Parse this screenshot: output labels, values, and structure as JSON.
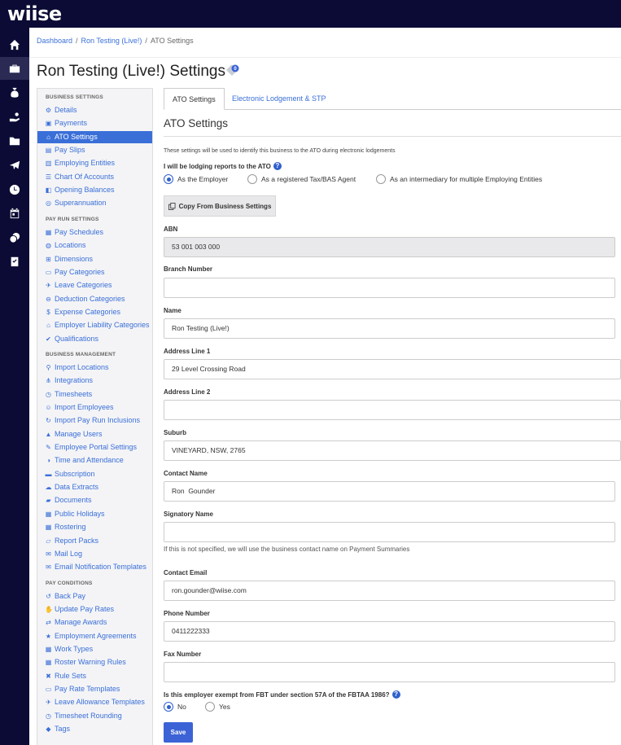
{
  "app": {
    "logo": "wiise"
  },
  "rail": [
    {
      "icon": "home-icon"
    },
    {
      "icon": "briefcase-icon"
    },
    {
      "icon": "moneybag-icon"
    },
    {
      "icon": "hand-coins-icon"
    },
    {
      "icon": "folder-icon"
    },
    {
      "icon": "plane-icon"
    },
    {
      "icon": "clock-icon"
    },
    {
      "icon": "calendar-icon"
    },
    {
      "icon": "coins-icon"
    },
    {
      "icon": "clipboard-check-icon"
    }
  ],
  "breadcrumb": {
    "items": [
      "Dashboard",
      "Ron Testing (Live!)",
      "ATO Settings"
    ],
    "sep": "/"
  },
  "page": {
    "title": "Ron Testing (Live!) Settings",
    "tag_badge": "0"
  },
  "sidebar": {
    "sections": [
      {
        "title": "BUSINESS SETTINGS",
        "items": [
          {
            "label": "Details",
            "icon": "gear-icon"
          },
          {
            "label": "Payments",
            "icon": "save-icon"
          },
          {
            "label": "ATO Settings",
            "icon": "bank-icon",
            "active": true
          },
          {
            "label": "Pay Slips",
            "icon": "file-icon"
          },
          {
            "label": "Employing Entities",
            "icon": "building-icon"
          },
          {
            "label": "Chart Of Accounts",
            "icon": "list-icon"
          },
          {
            "label": "Opening Balances",
            "icon": "ledger-icon"
          },
          {
            "label": "Superannuation",
            "icon": "lifebuoy-icon"
          }
        ]
      },
      {
        "title": "PAY RUN SETTINGS",
        "items": [
          {
            "label": "Pay Schedules",
            "icon": "calendar-icon"
          },
          {
            "label": "Locations",
            "icon": "globe-icon"
          },
          {
            "label": "Dimensions",
            "icon": "grid-icon"
          },
          {
            "label": "Pay Categories",
            "icon": "money-icon"
          },
          {
            "label": "Leave Categories",
            "icon": "plane-icon"
          },
          {
            "label": "Deduction Categories",
            "icon": "minus-circle-icon"
          },
          {
            "label": "Expense Categories",
            "icon": "dollar-circle-icon"
          },
          {
            "label": "Employer Liability Categories",
            "icon": "bank-icon"
          },
          {
            "label": "Qualifications",
            "icon": "check-icon"
          }
        ]
      },
      {
        "title": "BUSINESS MANAGEMENT",
        "items": [
          {
            "label": "Import Locations",
            "icon": "map-pin-icon"
          },
          {
            "label": "Integrations",
            "icon": "sitemap-icon"
          },
          {
            "label": "Timesheets",
            "icon": "clock-icon"
          },
          {
            "label": "Import Employees",
            "icon": "users-icon"
          },
          {
            "label": "Import Pay Run Inclusions",
            "icon": "refresh-icon"
          },
          {
            "label": "Manage Users",
            "icon": "lock-icon"
          },
          {
            "label": "Employee Portal Settings",
            "icon": "pencil-icon"
          },
          {
            "label": "Time and Attendance",
            "icon": "user-clock-icon"
          },
          {
            "label": "Subscription",
            "icon": "credit-card-icon"
          },
          {
            "label": "Data Extracts",
            "icon": "cloud-download-icon"
          },
          {
            "label": "Documents",
            "icon": "folder-icon"
          },
          {
            "label": "Public Holidays",
            "icon": "calendar-icon"
          },
          {
            "label": "Rostering",
            "icon": "calendar-grid-icon"
          },
          {
            "label": "Report Packs",
            "icon": "folder-open-icon"
          },
          {
            "label": "Mail Log",
            "icon": "envelope-icon"
          },
          {
            "label": "Email Notification Templates",
            "icon": "envelope-icon"
          }
        ]
      },
      {
        "title": "PAY CONDITIONS",
        "items": [
          {
            "label": "Back Pay",
            "icon": "history-icon"
          },
          {
            "label": "Update Pay Rates",
            "icon": "hand-coins-icon"
          },
          {
            "label": "Manage Awards",
            "icon": "exchange-icon"
          },
          {
            "label": "Employment Agreements",
            "icon": "star-icon"
          },
          {
            "label": "Work Types",
            "icon": "calendar-icon"
          },
          {
            "label": "Roster Warning Rules",
            "icon": "calendar-icon"
          },
          {
            "label": "Rule Sets",
            "icon": "wrench-icon"
          },
          {
            "label": "Pay Rate Templates",
            "icon": "money-icon"
          },
          {
            "label": "Leave Allowance Templates",
            "icon": "plane-icon"
          },
          {
            "label": "Timesheet Rounding",
            "icon": "clock-icon"
          },
          {
            "label": "Tags",
            "icon": "tag-icon"
          }
        ]
      }
    ]
  },
  "tabs": [
    {
      "label": "ATO Settings",
      "active": true
    },
    {
      "label": "Electronic Lodgement & STP",
      "active": false
    }
  ],
  "section_title": "ATO Settings",
  "note": "These settings will be used to identify this business to the ATO during electronic lodgements",
  "lodging": {
    "question": "I will be lodging reports to the ATO",
    "options": [
      "As the Employer",
      "As a registered Tax/BAS Agent",
      "As an intermediary for multiple Employing Entities"
    ],
    "selected": 0
  },
  "copy_button": "Copy From Business Settings",
  "fields": [
    {
      "label": "ABN",
      "value": "53 001 003 000",
      "readonly": true
    },
    {
      "label": "Branch Number",
      "value": ""
    },
    {
      "label": "Name",
      "value": "Ron Testing (Live!)"
    },
    {
      "label": "Address Line 1",
      "value": "29 Level Crossing Road"
    },
    {
      "label": "Address Line 2",
      "value": ""
    },
    {
      "label": "Suburb",
      "value": "VINEYARD, NSW, 2765"
    },
    {
      "label": "Contact Name",
      "value": "Ron  Gounder"
    },
    {
      "label": "Signatory Name",
      "value": ""
    },
    {
      "label": "Contact Email",
      "value": "ron.gounder@wiise.com"
    },
    {
      "label": "Phone Number",
      "value": "0411222333"
    },
    {
      "label": "Fax Number",
      "value": ""
    }
  ],
  "signatory_hint": "If this is not specified, we will use the business contact name on Payment Summaries",
  "fbt": {
    "question": "Is this employer exempt from FBT under section 57A of the FBTAA 1986?",
    "options": [
      "No",
      "Yes"
    ],
    "selected": 0
  },
  "save_button": "Save",
  "colors": {
    "brand_dark": "#0b0b35",
    "accent": "#3a6fd8",
    "save": "#3b63d6"
  }
}
